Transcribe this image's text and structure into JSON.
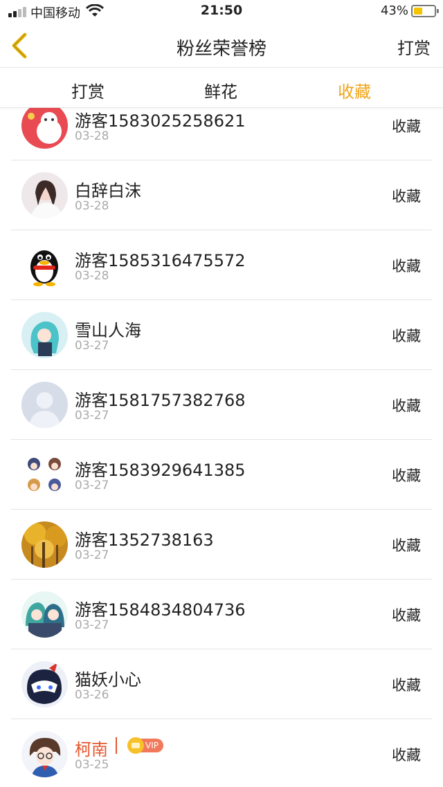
{
  "status_bar": {
    "carrier": "中国移动",
    "time": "21:50",
    "battery": "43%",
    "battery_level": 0.43
  },
  "nav": {
    "title": "粉丝荣誉榜",
    "right_label": "打赏",
    "back_icon": "chevron-left-icon",
    "accent": "#f2a51a"
  },
  "tabs": [
    {
      "label": "打赏",
      "active": false
    },
    {
      "label": "鲜花",
      "active": false
    },
    {
      "label": "收藏",
      "active": true
    }
  ],
  "fans": [
    {
      "name": "游客1583025258621",
      "date": "03-28",
      "action": "收藏",
      "avatar": "red-cartoon-avatar"
    },
    {
      "name": "白辞白沫",
      "date": "03-28",
      "action": "收藏",
      "avatar": "girl-photo-avatar"
    },
    {
      "name": "游客1585316475572",
      "date": "03-28",
      "action": "收藏",
      "avatar": "qq-penguin-avatar"
    },
    {
      "name": "雪山人海",
      "date": "03-27",
      "action": "收藏",
      "avatar": "anime-teal-avatar"
    },
    {
      "name": "游客1581757382768",
      "date": "03-27",
      "action": "收藏",
      "avatar": "default-person-avatar"
    },
    {
      "name": "游客1583929641385",
      "date": "03-27",
      "action": "收藏",
      "avatar": "chibi-grid-avatar"
    },
    {
      "name": "游客1352738163",
      "date": "03-27",
      "action": "收藏",
      "avatar": "autumn-tree-avatar"
    },
    {
      "name": "游客1584834804736",
      "date": "03-27",
      "action": "收藏",
      "avatar": "anime-pair-avatar"
    },
    {
      "name": "猫妖小心",
      "date": "03-26",
      "action": "收藏",
      "avatar": "masked-cat-avatar"
    },
    {
      "name": "柯南",
      "date": "03-25",
      "action": "收藏",
      "avatar": "conan-avatar",
      "vip": "VIP"
    }
  ]
}
